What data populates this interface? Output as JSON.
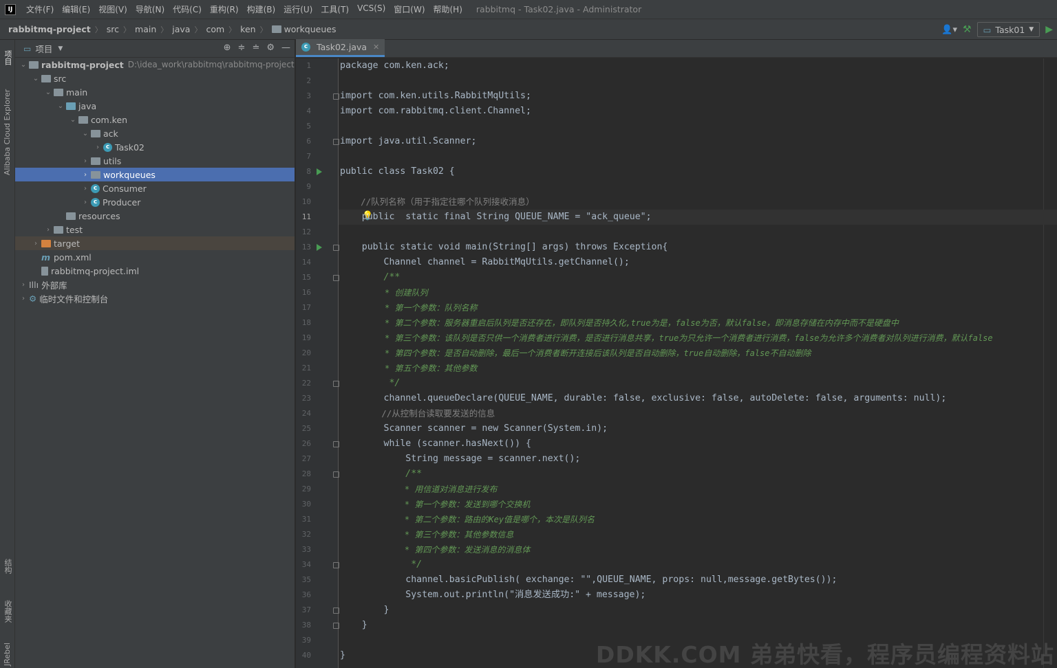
{
  "menubar": {
    "items": [
      "文件(F)",
      "编辑(E)",
      "视图(V)",
      "导航(N)",
      "代码(C)",
      "重构(R)",
      "构建(B)",
      "运行(U)",
      "工具(T)",
      "VCS(S)",
      "窗口(W)",
      "帮助(H)"
    ],
    "title": "rabbitmq - Task02.java - Administrator"
  },
  "breadcrumb": {
    "items": [
      "rabbitmq-project",
      "src",
      "main",
      "java",
      "com",
      "ken",
      "workqueues"
    ]
  },
  "run_config": {
    "label": "Task01"
  },
  "left_strip": {
    "project": "项目",
    "cloud": "Alibaba Cloud Explorer",
    "structure": "结构",
    "favorites": "收藏夹",
    "jrebel": "JRebel"
  },
  "project_panel": {
    "title": "项目",
    "tree": [
      {
        "label": "rabbitmq-project",
        "path": "D:\\idea_work\\rabbitmq\\rabbitmq-project",
        "depth": 0
      },
      {
        "label": "src",
        "depth": 1
      },
      {
        "label": "main",
        "depth": 2
      },
      {
        "label": "java",
        "depth": 3
      },
      {
        "label": "com.ken",
        "depth": 4
      },
      {
        "label": "ack",
        "depth": 5
      },
      {
        "label": "Task02",
        "depth": 6
      },
      {
        "label": "utils",
        "depth": 5
      },
      {
        "label": "workqueues",
        "depth": 5
      },
      {
        "label": "Consumer",
        "depth": 5
      },
      {
        "label": "Producer",
        "depth": 5
      },
      {
        "label": "resources",
        "depth": 3
      },
      {
        "label": "test",
        "depth": 2
      },
      {
        "label": "target",
        "depth": 1
      },
      {
        "label": "pom.xml",
        "depth": 1
      },
      {
        "label": "rabbitmq-project.iml",
        "depth": 1
      },
      {
        "label": "外部库",
        "depth": 0
      },
      {
        "label": "临时文件和控制台",
        "depth": 0
      }
    ]
  },
  "editor": {
    "tab": "Task02.java",
    "line_numbers": [
      "1",
      "2",
      "3",
      "4",
      "5",
      "6",
      "7",
      "8",
      "9",
      "10",
      "11",
      "12",
      "13",
      "14",
      "15",
      "16",
      "17",
      "18",
      "19",
      "20",
      "21",
      "22",
      "23",
      "24",
      "25",
      "26",
      "27",
      "28",
      "29",
      "30",
      "31",
      "32",
      "33",
      "34",
      "35",
      "36",
      "37",
      "38",
      "39",
      "40"
    ],
    "code": {
      "l1": "package com.ken.ack;",
      "l3": "import com.ken.utils.RabbitMqUtils;",
      "l4": "import com.rabbitmq.client.Channel;",
      "l6": "import java.util.Scanner;",
      "l8": "public class Task02 {",
      "l10": "    //队列名称（用于指定往哪个队列接收消息）",
      "l11": "    public  static final String QUEUE_NAME = \"ack_queue\";",
      "l13": "    public static void main(String[] args) throws Exception{",
      "l14": "        Channel channel = RabbitMqUtils.getChannel();",
      "l15": "        /**",
      "l16": "         * 创建队列",
      "l17": "         * 第一个参数：队列名称",
      "l18": "         * 第二个参数：服务器重启后队列是否还存在，即队列是否持久化,true为是，false为否，默认false，即消息存储在内存中而不是硬盘中",
      "l19": "         * 第三个参数：该队列是否只供一个消费者进行消费，是否进行消息共享，true为只允许一个消费者进行消费，false为允许多个消费者对队列进行消费，默认false",
      "l20": "         * 第四个参数：是否自动删除，最后一个消费者断开连接后该队列是否自动删除，true自动删除，false不自动删除",
      "l21": "         * 第五个参数：其他参数",
      "l22": "         */",
      "l23": "        channel.queueDeclare(QUEUE_NAME, durable: false, exclusive: false, autoDelete: false, arguments: null);",
      "l24": "        //从控制台读取要发送的信息",
      "l25": "        Scanner scanner = new Scanner(System.in);",
      "l26": "        while (scanner.hasNext()) {",
      "l27": "            String message = scanner.next();",
      "l28": "            /**",
      "l29": "             * 用信道对消息进行发布",
      "l30": "             * 第一个参数：发送到哪个交换机",
      "l31": "             * 第二个参数：路由的Key值是哪个，本次是队列名",
      "l32": "             * 第三个参数：其他参数信息",
      "l33": "             * 第四个参数：发送消息的消息体",
      "l34": "             */",
      "l35": "            channel.basicPublish( exchange: \"\",QUEUE_NAME, props: null,message.getBytes());",
      "l36": "            System.out.println(\"消息发送成功:\" + message);",
      "l37": "        }",
      "l38": "    }",
      "l40": "}"
    }
  },
  "watermark": "DDKK.COM 弟弟快看，程序员编程资料站"
}
